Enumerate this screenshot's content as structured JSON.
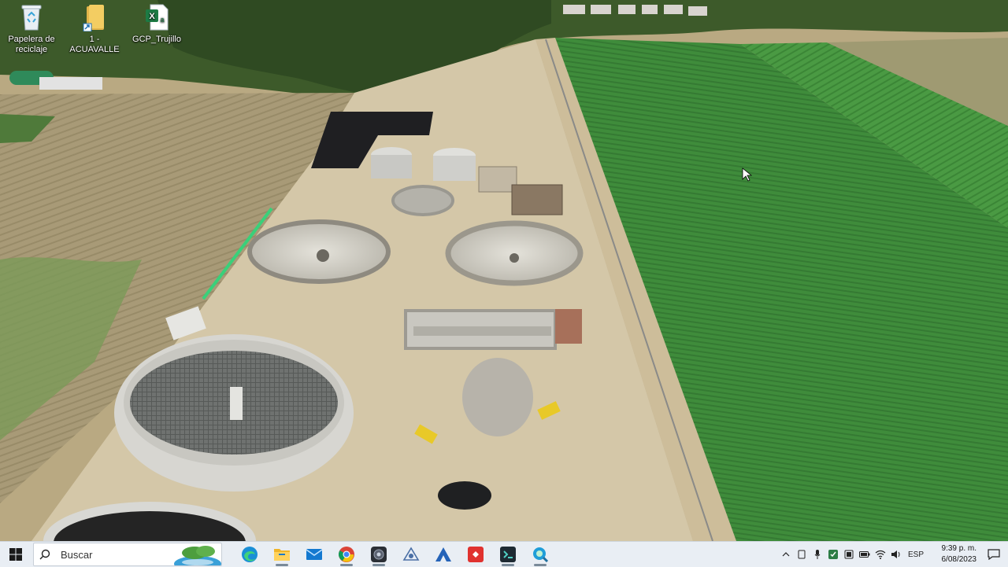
{
  "desktop": {
    "icons": [
      {
        "label": "Papelera de reciclaje",
        "icon": "recycle-bin-icon"
      },
      {
        "label": "1 - ACUAVALLE",
        "icon": "folder-icon"
      },
      {
        "label": "GCP_Trujillo",
        "icon": "excel-file-icon"
      }
    ]
  },
  "taskbar": {
    "search_placeholder": "Buscar",
    "apps": [
      {
        "name": "Microsoft Edge",
        "icon": "edge-icon"
      },
      {
        "name": "File Explorer",
        "icon": "folder-icon"
      },
      {
        "name": "Mail",
        "icon": "mail-icon"
      },
      {
        "name": "Google Chrome",
        "icon": "chrome-icon"
      },
      {
        "name": "App",
        "icon": "camera-app-icon"
      },
      {
        "name": "App",
        "icon": "drive-icon"
      },
      {
        "name": "App",
        "icon": "autodesk-icon"
      },
      {
        "name": "App",
        "icon": "anydesk-icon"
      },
      {
        "name": "App",
        "icon": "terminal-icon"
      },
      {
        "name": "App",
        "icon": "search-app-icon"
      }
    ],
    "tray": {
      "language": "ESP",
      "time": "9:39 p. m.",
      "date": "6/08/2023"
    }
  },
  "colors": {
    "taskbar_bg": "#e9eef4",
    "field_green": "#3f8a3a",
    "soil": "#c9b896"
  }
}
